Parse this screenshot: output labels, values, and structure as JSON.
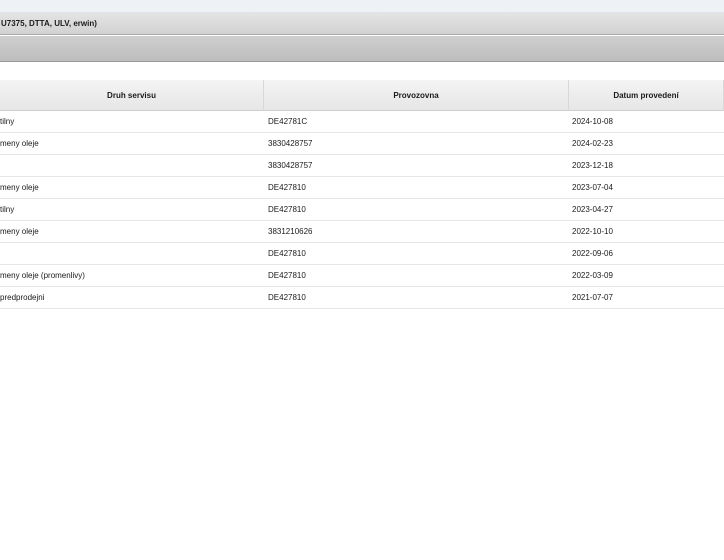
{
  "window": {
    "title": "U7375, DTTA, ULV, erwin)"
  },
  "table": {
    "columns": [
      "Druh servisu",
      "Provozovna",
      "Datum provedení"
    ],
    "rows": [
      {
        "type": "tilny",
        "site": "DE42781C",
        "date": "2024-10-08"
      },
      {
        "type": "meny oleje",
        "site": "3830428757",
        "date": "2024-02-23"
      },
      {
        "type": "",
        "site": "3830428757",
        "date": "2023-12-18"
      },
      {
        "type": "meny oleje",
        "site": "DE427810",
        "date": "2023-07-04"
      },
      {
        "type": "tilny",
        "site": "DE427810",
        "date": "2023-04-27"
      },
      {
        "type": "meny oleje",
        "site": "3831210626",
        "date": "2022-10-10"
      },
      {
        "type": "",
        "site": "DE427810",
        "date": "2022-09-06"
      },
      {
        "type": "meny oleje (promenlivy)",
        "site": "DE427810",
        "date": "2022-03-09"
      },
      {
        "type": "predprodejni",
        "site": "DE427810",
        "date": "2021-07-07"
      }
    ]
  }
}
